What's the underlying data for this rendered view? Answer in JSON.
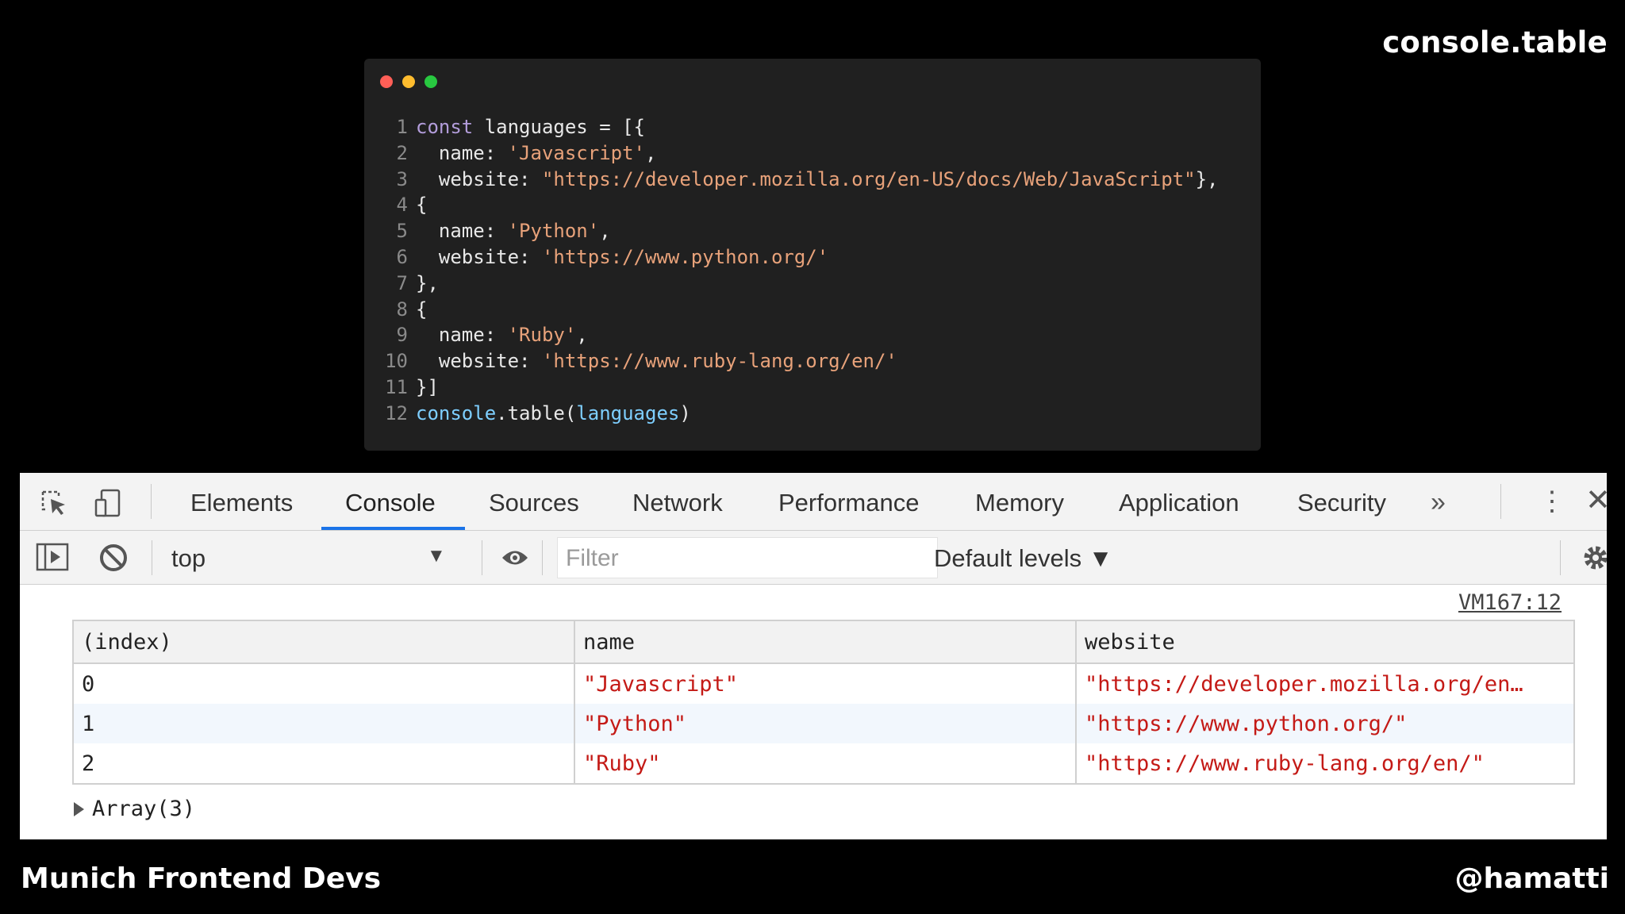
{
  "slide": {
    "title": "console.table",
    "footer_left": "Munich Frontend Devs",
    "footer_right": "@hamatti"
  },
  "code_window": {
    "dot_colors": [
      "#ff5f57",
      "#febc2e",
      "#28c840"
    ],
    "lines": [
      {
        "n": "1",
        "tokens": [
          [
            "kw",
            "const"
          ],
          [
            "plain",
            " languages = [{"
          ]
        ]
      },
      {
        "n": "2",
        "tokens": [
          [
            "plain",
            "  name: "
          ],
          [
            "str",
            "'Javascript'"
          ],
          [
            "plain",
            ","
          ]
        ]
      },
      {
        "n": "3",
        "tokens": [
          [
            "plain",
            "  website: "
          ],
          [
            "str",
            "\"https://developer.mozilla.org/en-US/docs/Web/JavaScript\""
          ],
          [
            "plain",
            "},"
          ]
        ]
      },
      {
        "n": "4",
        "tokens": [
          [
            "plain",
            "{"
          ]
        ]
      },
      {
        "n": "5",
        "tokens": [
          [
            "plain",
            "  name: "
          ],
          [
            "str",
            "'Python'"
          ],
          [
            "plain",
            ","
          ]
        ]
      },
      {
        "n": "6",
        "tokens": [
          [
            "plain",
            "  website: "
          ],
          [
            "str",
            "'https://www.python.org/'"
          ]
        ]
      },
      {
        "n": "7",
        "tokens": [
          [
            "plain",
            "},"
          ]
        ]
      },
      {
        "n": "8",
        "tokens": [
          [
            "plain",
            "{"
          ]
        ]
      },
      {
        "n": "9",
        "tokens": [
          [
            "plain",
            "  name: "
          ],
          [
            "str",
            "'Ruby'"
          ],
          [
            "plain",
            ","
          ]
        ]
      },
      {
        "n": "10",
        "tokens": [
          [
            "plain",
            "  website: "
          ],
          [
            "str",
            "'https://www.ruby-lang.org/en/'"
          ]
        ]
      },
      {
        "n": "11",
        "tokens": [
          [
            "plain",
            "}]"
          ]
        ]
      },
      {
        "n": "12",
        "tokens": [
          [
            "fn",
            "console"
          ],
          [
            "plain",
            ".table("
          ],
          [
            "fn",
            "languages"
          ],
          [
            "plain",
            ")"
          ]
        ]
      }
    ]
  },
  "devtools": {
    "tabs": [
      "Elements",
      "Console",
      "Sources",
      "Network",
      "Performance",
      "Memory",
      "Application",
      "Security"
    ],
    "active_tab": "Console",
    "accent_color": "#1a73e8",
    "overflow_label": "»",
    "kebab_label": "⋮",
    "close_label": "✕",
    "toolbar": {
      "context": "top",
      "context_arrow": "▼",
      "filter_placeholder": "Filter",
      "levels": "Default levels ▼"
    },
    "source_link": "VM167:12",
    "table": {
      "columns": [
        "(index)",
        "name",
        "website"
      ],
      "rows": [
        [
          "0",
          "\"Javascript\"",
          "\"https://developer.mozilla.org/en…"
        ],
        [
          "1",
          "\"Python\"",
          "\"https://www.python.org/\""
        ],
        [
          "2",
          "\"Ruby\"",
          "\"https://www.ruby-lang.org/en/\""
        ]
      ]
    },
    "array_summary": "Array(3)"
  }
}
